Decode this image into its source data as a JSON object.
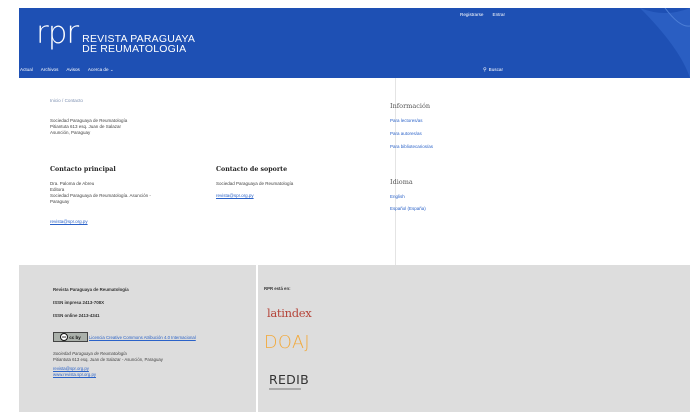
{
  "header": {
    "logo_mark": "rpr",
    "logo_line1": "REVISTA PARAGUAYA",
    "logo_line2": "DE REUMATOLOGIA",
    "bg_color": "#1e50b4",
    "user_nav": [
      "Registrarse",
      "Entrar"
    ],
    "nav": [
      "Actual",
      "Archivos",
      "Avisos",
      "Acerca de"
    ],
    "nav_dropdown_icon": "chevron-down-icon",
    "search_label": "Buscar"
  },
  "main": {
    "breadcrumb": [
      "Inicio",
      "Contacto"
    ],
    "breadcrumb_separator": "/",
    "address": [
      "Sociedad Paraguaya de Reumatología",
      "Pitiantuta 613 esq. Juan de Salazar",
      "Asunción, Paraguay"
    ],
    "principal": {
      "title": "Contacto principal",
      "name": "Dra. Paloma de Abreu",
      "role": "Editora",
      "affiliation_line1": "Sociedad Paraguaya de Reumatología. Asunción -",
      "affiliation_line2": "Paraguay",
      "email": "revista@spr.org.py"
    },
    "support": {
      "title": "Contacto de soporte",
      "name": "Sociedad Paraguaya de Reumatología",
      "email": "revista@spr.org.py"
    }
  },
  "sidebar": {
    "info_title": "Información",
    "info_links": [
      "Para lectores/as",
      "Para autores/as",
      "Para bibliotecarios/as"
    ],
    "lang_title": "Idioma",
    "lang_links": [
      "English",
      "Español (España)"
    ]
  },
  "footer": {
    "journal": "Revista Paraguaya de Reumatología",
    "issn_print": "ISSN impresa 2413-708X",
    "issn_online": "ISSN online 2413-4341",
    "cc_badge": "cc by",
    "license": "Licencia Creative Commons Atribución 4.0 Internacional",
    "society": "Sociedad Paraguaya de Reumatología",
    "address": "Pitiantuta 613 esq. Juan de Salazar - Asunción, Paraguay",
    "email": "revista@spr.org.py",
    "web": "www.revista.spr.org.py",
    "indexed_heading": "RPR está en:",
    "indexes": [
      "latindex",
      "DOAJ",
      "REDIB"
    ]
  }
}
